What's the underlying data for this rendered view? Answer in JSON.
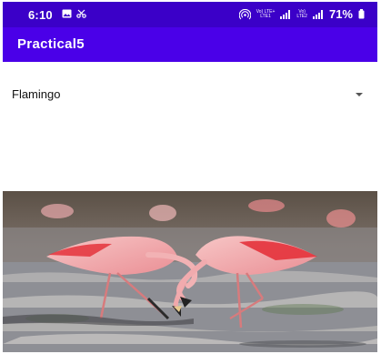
{
  "status_bar": {
    "time": "6:10",
    "left_icons": [
      "image-icon",
      "scissors-icon"
    ],
    "right_icons": [
      "hotspot-icon",
      "signal-icon",
      "signal-icon",
      "battery-icon"
    ],
    "network_1": "Vo) LTE+\nLTE1",
    "network_2": "Vo)\nLTE2",
    "battery": "71%"
  },
  "app_bar": {
    "title": "Practical5"
  },
  "spinner": {
    "selected": "Flamingo"
  },
  "image": {
    "subject": "flamingo-photo"
  },
  "colors": {
    "status_bar": "#3b00c8",
    "app_bar": "#4a00e8",
    "accent": "#ffffff"
  }
}
